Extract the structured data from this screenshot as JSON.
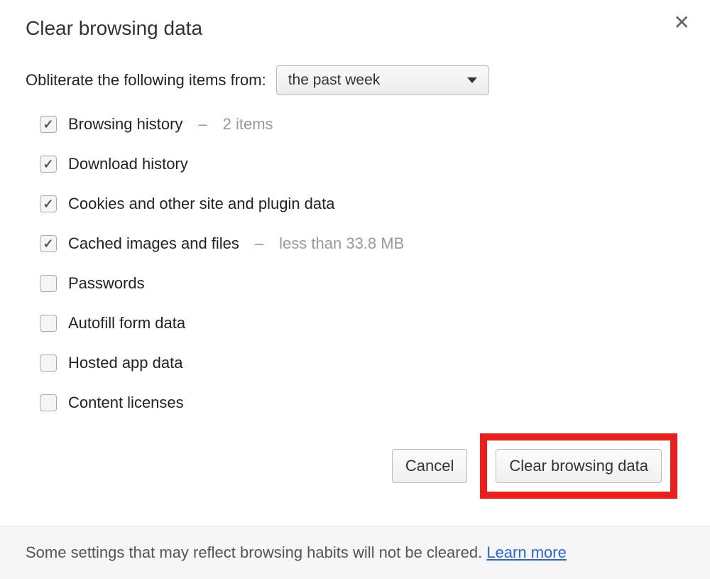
{
  "dialog": {
    "title": "Clear browsing data",
    "obliterate_label": "Obliterate the following items from:",
    "dropdown_value": "the past week"
  },
  "options": [
    {
      "label": "Browsing history",
      "checked": true,
      "detail": "2 items"
    },
    {
      "label": "Download history",
      "checked": true,
      "detail": ""
    },
    {
      "label": "Cookies and other site and plugin data",
      "checked": true,
      "detail": ""
    },
    {
      "label": "Cached images and files",
      "checked": true,
      "detail": "less than 33.8 MB"
    },
    {
      "label": "Passwords",
      "checked": false,
      "detail": ""
    },
    {
      "label": "Autofill form data",
      "checked": false,
      "detail": ""
    },
    {
      "label": "Hosted app data",
      "checked": false,
      "detail": ""
    },
    {
      "label": "Content licenses",
      "checked": false,
      "detail": ""
    }
  ],
  "buttons": {
    "cancel": "Cancel",
    "clear": "Clear browsing data"
  },
  "footer": {
    "text": "Some settings that may reflect browsing habits will not be cleared.",
    "learn_more": "Learn more"
  }
}
